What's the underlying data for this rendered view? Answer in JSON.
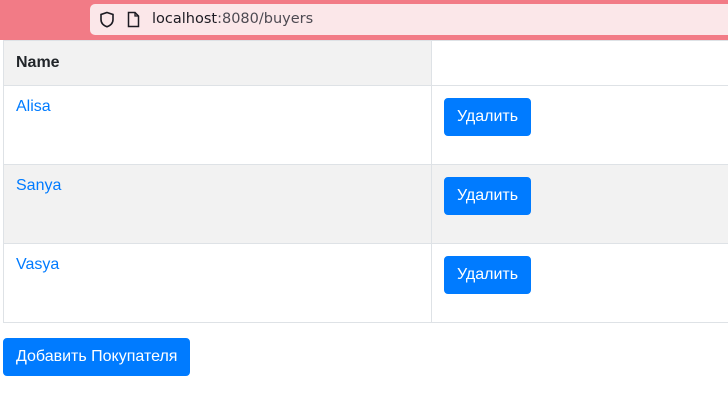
{
  "browser": {
    "url_host": "localhost",
    "url_path": ":8080/buyers"
  },
  "table": {
    "header_name": "Name",
    "header_actions": "",
    "rows": [
      {
        "name": "Alisa",
        "delete_label": "Удалить"
      },
      {
        "name": "Sanya",
        "delete_label": "Удалить"
      },
      {
        "name": "Vasya",
        "delete_label": "Удалить"
      }
    ]
  },
  "add_button_label": "Добавить Покупателя",
  "colors": {
    "browser_bar": "#f27b86",
    "url_box": "#fbe7e9",
    "primary": "#007bff",
    "striped_row": "#f2f2f2"
  }
}
